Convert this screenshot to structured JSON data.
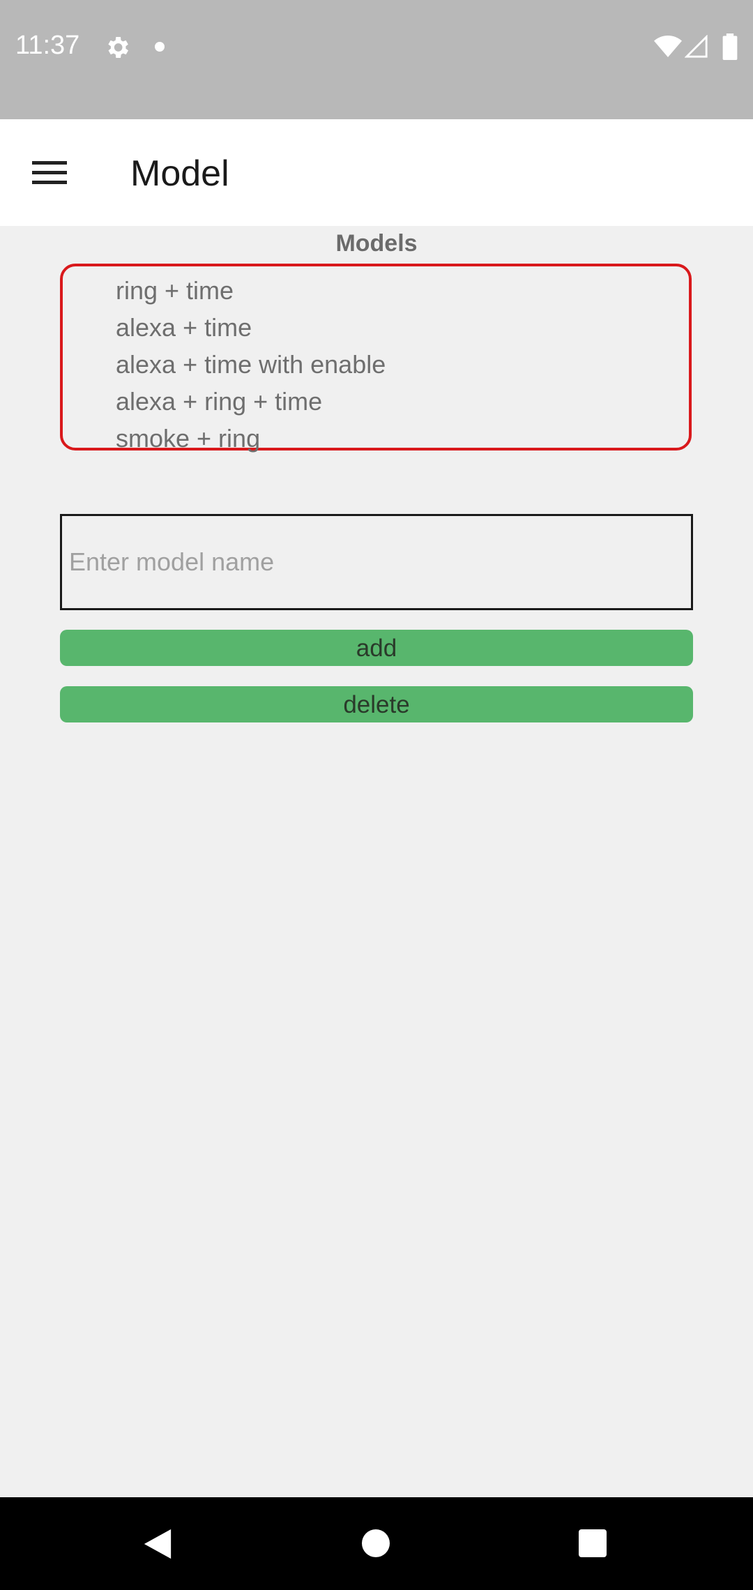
{
  "status_bar": {
    "time": "11:37",
    "icons": [
      "gear-icon",
      "notification-dot-icon",
      "wifi-icon",
      "signal-icon",
      "battery-icon"
    ]
  },
  "app_bar": {
    "title": "Model",
    "menu_icon": "hamburger-menu-icon"
  },
  "models": {
    "heading": "Models",
    "items": [
      "ring + time",
      "alexa + time",
      "alexa + time with enable",
      "alexa + ring + time",
      "smoke + ring"
    ]
  },
  "model_input": {
    "value": "",
    "placeholder": "Enter model name"
  },
  "buttons": {
    "add_label": "add",
    "delete_label": "delete"
  },
  "nav_bar": {
    "icons": [
      "back-icon",
      "home-icon",
      "recents-icon"
    ]
  },
  "colors": {
    "status_bar": "#b8b8b8",
    "list_border": "#d9191c",
    "button_green": "#58b66d",
    "background": "#f0f0f0"
  }
}
